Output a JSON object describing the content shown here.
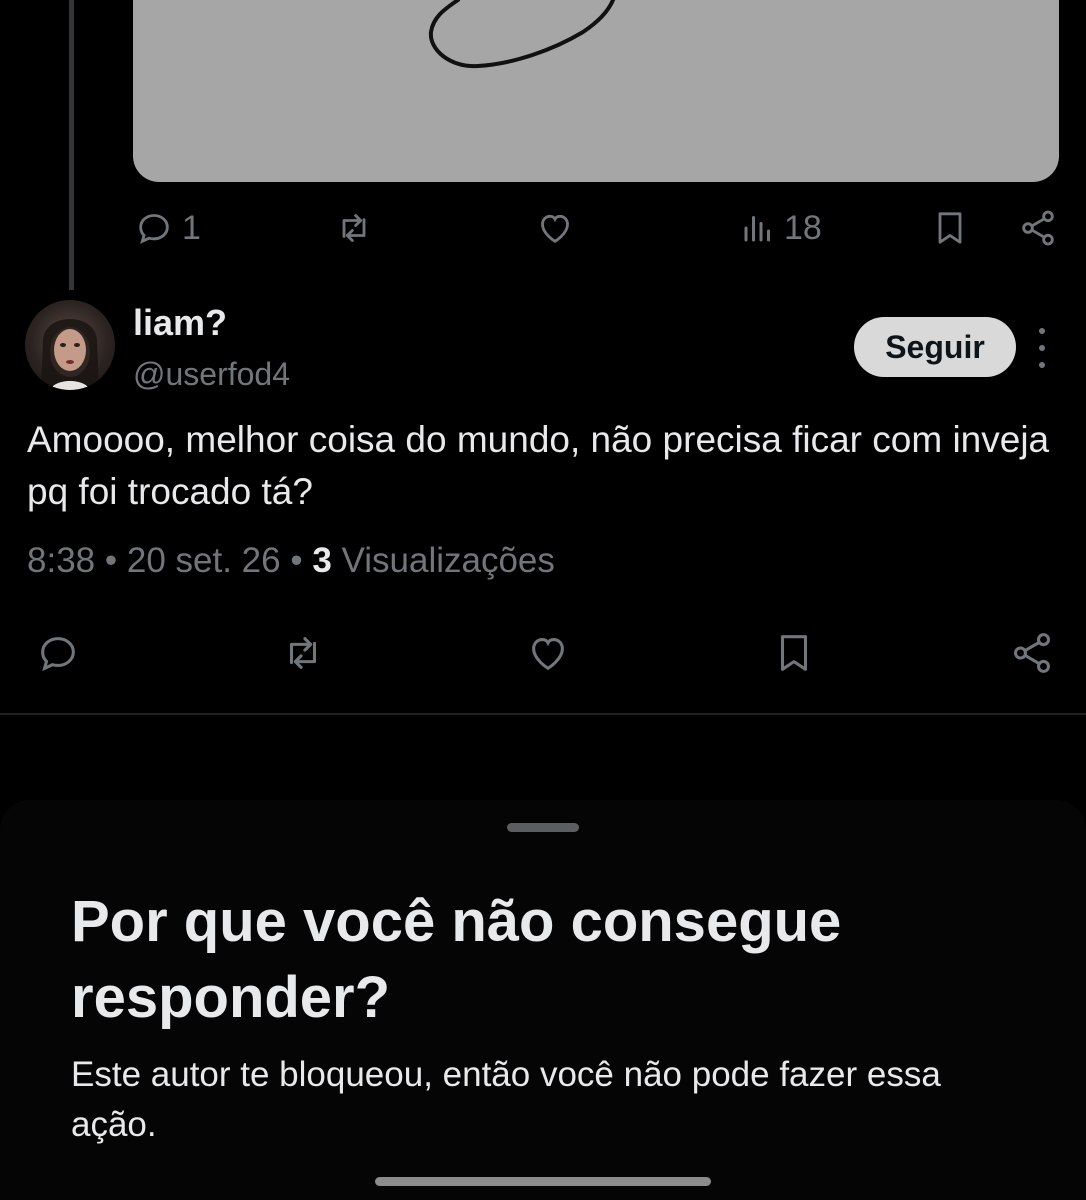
{
  "parent_tweet": {
    "actions": {
      "reply_count": "1",
      "views_count": "18"
    }
  },
  "reply_tweet": {
    "display_name": "liam?",
    "handle": "@userfod4",
    "follow_label": "Seguir",
    "text": "Amoooo, melhor coisa do mundo, não precisa ficar com inveja pq foi trocado tá?",
    "time": "8:38",
    "date": "20 set. 26",
    "views_count": "3",
    "views_label": "Visualizações",
    "separator": "•"
  },
  "sheet": {
    "title": "Por que você não consegue responder?",
    "body": "Este autor te bloqueou, então você não pode fazer essa ação."
  },
  "icons": {
    "reply": "comment-icon",
    "retweet": "repost-icon",
    "like": "heart-icon",
    "views": "views-bar-chart-icon",
    "bookmark": "bookmark-icon",
    "share": "share-icon",
    "more": "more-vertical-icon"
  },
  "colors": {
    "background": "#000000",
    "text_primary": "#e7e9ea",
    "text_secondary": "#71767b",
    "follow_button_bg": "#d9d9d9",
    "media_bg": "#a6a6a6"
  }
}
